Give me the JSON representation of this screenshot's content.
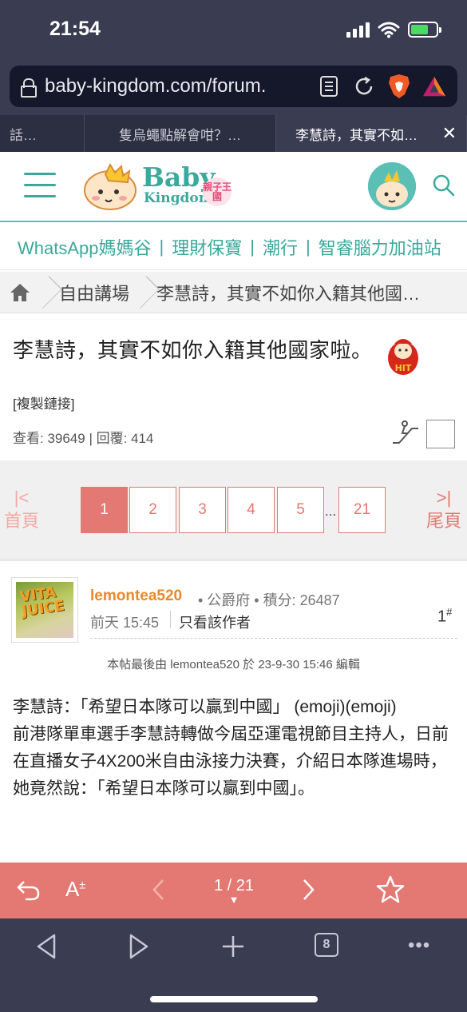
{
  "status_bar": {
    "time": "21:54"
  },
  "browser": {
    "url": "baby-kingdom.com/forum.",
    "tabs": [
      {
        "label": "話…",
        "active": false
      },
      {
        "label": "隻烏蠅點解會咁？…",
        "active": false
      },
      {
        "label": "李慧詩，其實不如…",
        "active": true
      }
    ],
    "tab_count": "8"
  },
  "header": {
    "logo_baby": "Baby",
    "logo_kingdom": "Kingdom",
    "logo_sub": "親子王國"
  },
  "category_nav": {
    "items": [
      "WhatsApp媽媽谷",
      "理財保寶",
      "潮行",
      "智睿腦力加油站"
    ]
  },
  "breadcrumb": {
    "forum": "自由講場",
    "thread": "李慧詩，其實不如你入籍其他國家啦。"
  },
  "thread": {
    "title": "李慧詩，其實不如你入籍其他國家啦。",
    "badge": "HIT",
    "copy_link": "[複製鏈接]",
    "stats": "查看: 39649 | 回覆: 414"
  },
  "pagination": {
    "first_label": "首頁",
    "last_label": "尾頁",
    "pages": [
      "1",
      "2",
      "3",
      "4",
      "5"
    ],
    "dots": "...",
    "last_page": "21",
    "current": "1"
  },
  "post": {
    "avatar_text": "VITA JUICE",
    "author": "lemontea520",
    "meta": "• 公爵府 • 積分: 26487",
    "time": "前天 15:45",
    "only_author": "只看該作者",
    "floor": "1",
    "floor_sup": "#",
    "edit_note": "本帖最後由 lemontea520 於 23-9-30 15:46 編輯",
    "body_line1": "李慧詩：「希望日本隊可以贏到中國」 (emoji)(emoji)",
    "body_line2": "前港隊單車選手李慧詩轉做今屆亞運電視節目主持人，日前在直播女子4X200米自由泳接力決賽，介紹日本隊進場時，她竟然說：「希望日本隊可以贏到中國」。"
  },
  "reader_bar": {
    "page_indicator": "1 / 21",
    "caret": "▼"
  },
  "colors": {
    "brand_teal": "#3aa99c",
    "accent_red": "#e47872",
    "author_orange": "#e8892a",
    "chrome_dark": "#3a3d52"
  }
}
